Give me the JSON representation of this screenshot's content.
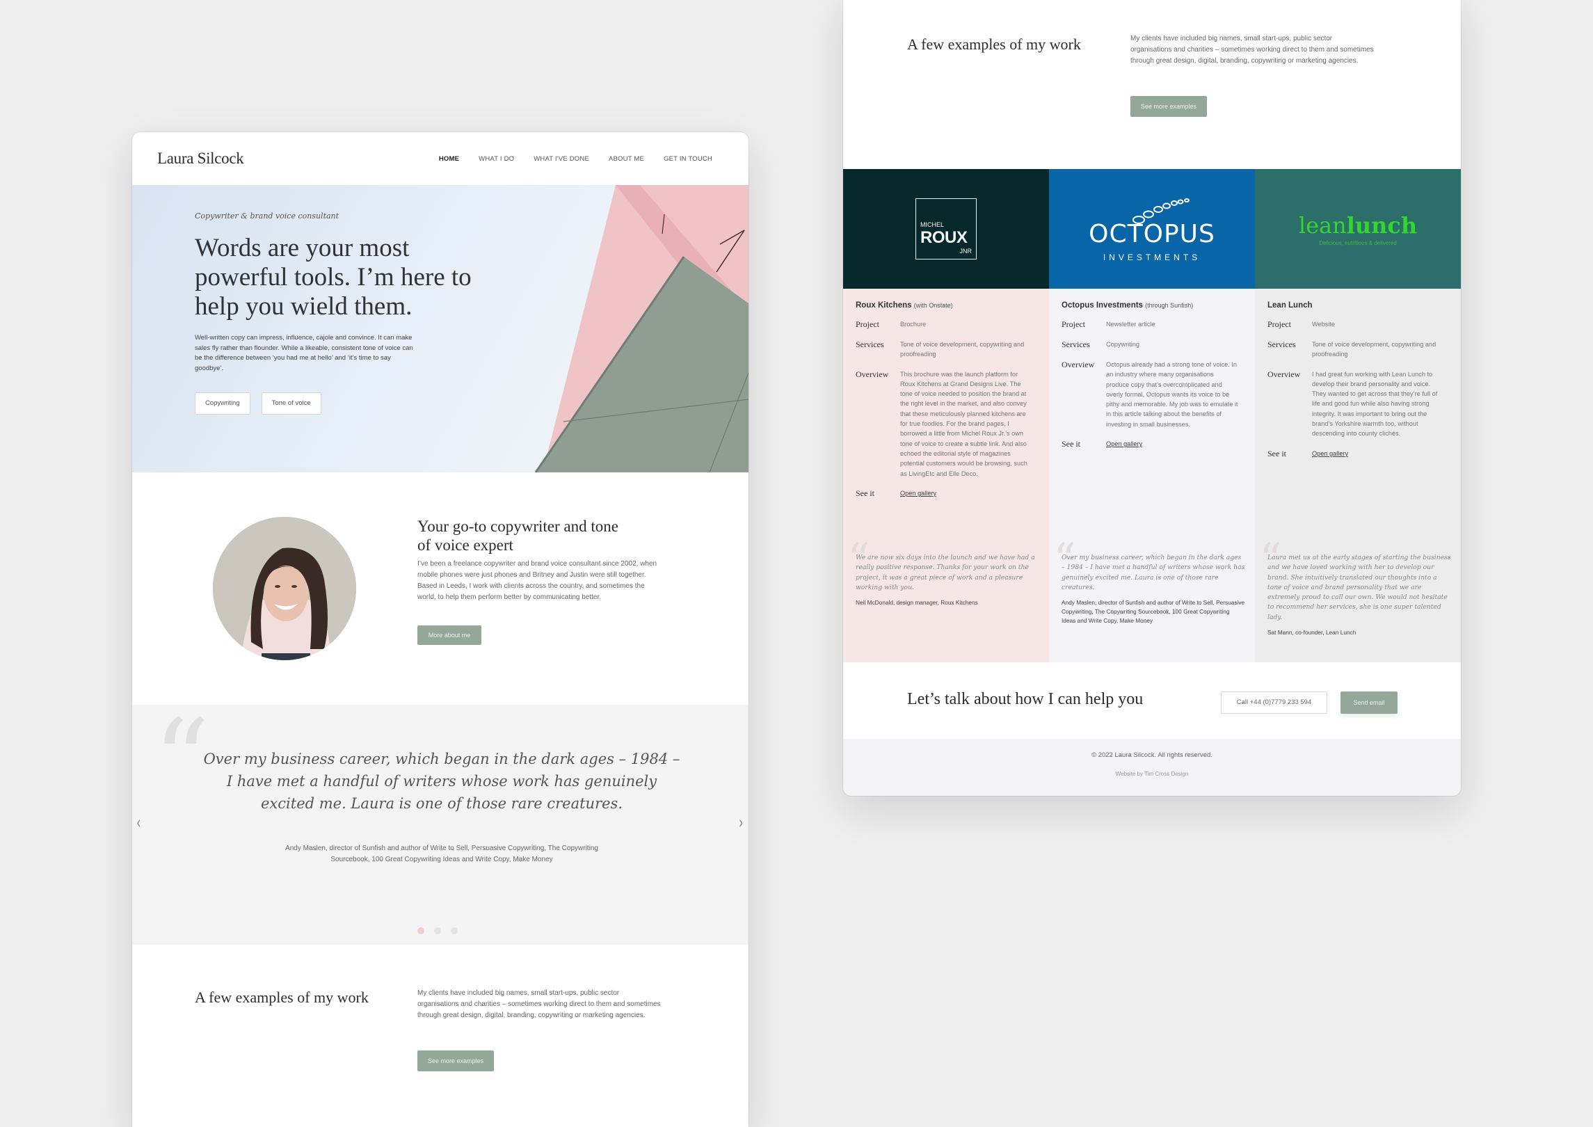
{
  "left_page": {
    "logo": "Laura Silcock",
    "nav": [
      {
        "label": "HOME",
        "active": true
      },
      {
        "label": "WHAT I DO",
        "active": false
      },
      {
        "label": "WHAT I'VE DONE",
        "active": false
      },
      {
        "label": "ABOUT ME",
        "active": false
      },
      {
        "label": "GET IN TOUCH",
        "active": false
      }
    ],
    "hero": {
      "subtitle": "Copywriter & brand voice consultant",
      "title": "Words are your most powerful tools. I’m here to help you wield them.",
      "body": "Well-written copy can impress, influence, cajole and convince. It can make sales fly rather than flounder. While a likeable, consistent tone of voice can be the difference between ‘you had me at hello’ and ‘it’s time to say goodbye’.",
      "buttons": [
        "Copywriting",
        "Tone of voice"
      ]
    },
    "about": {
      "title": "Your go-to copywriter and tone of voice expert",
      "body": "I’ve been a freelance copywriter and brand voice consultant since 2002, when mobile phones were just phones and Britney and Justin were still together. Based in Leeds, I work with clients across the country, and sometimes the world, to help them perform better by communicating better.",
      "button": "More about me"
    },
    "testimonial": {
      "quote": "Over my business career, which began in the dark ages – 1984 – I have met a handful of writers whose work has genuinely excited me. Laura is one of those rare creatures.",
      "attribution": "Andy Maslen, director of Sunfish and author of Write to Sell, Persuasive Copywriting, The Copywriting Sourcebook, 100 Great Copywriting Ideas and Write Copy, Make Money",
      "slide_count": 3,
      "active_slide": 1
    },
    "examples": {
      "title": "A few examples of my work",
      "body": "My clients have included big names, small start-ups, public sector organisations and charities – sometimes working direct to them and sometimes through great design, digital, branding, copywriting or marketing agencies.",
      "button": "See more examples"
    }
  },
  "right_page": {
    "examples": {
      "title": "A few examples of my work",
      "body": "My clients have included big names, small start-ups, public sector organisations and charities – sometimes working direct to them and sometimes through great design, digital, branding, copywriting or marketing agencies.",
      "button": "See more examples"
    },
    "logos": {
      "roux": {
        "line1": "MICHEL",
        "line2": "ROUX",
        "line3": "JNR",
        "bg": "#06282b"
      },
      "octopus": {
        "line1": "OCTOPUS",
        "line2": "INVESTMENTS",
        "bg": "#0865a8"
      },
      "leanlunch": {
        "light": "lean",
        "bold": "lunch",
        "tagline": "Delicious, nutritious & delivered",
        "bg": "#2c6e6a"
      }
    },
    "labels": {
      "project": "Project",
      "services": "Services",
      "overview": "Overview",
      "see_it": "See it",
      "link": "Open gallery"
    },
    "cases": [
      {
        "name": "Roux Kitchens",
        "via": "(with Onstate)",
        "project": "Brochure",
        "services": "Tone of voice development, copywriting and proofreading",
        "overview": "This brochure was the launch platform for Roux Kitchens at Grand Designs Live. The tone of voice needed to position the brand at the right level in the market, and also convey that these meticulously planned kitchens are for true foodies. For the brand pages, I borrowed a little from Michel Roux Jr.’s own tone of voice to create a subtle link. And also echoed the editorial style of magazines potential customers would be browsing, such as LivingEtc and Elle Deco.",
        "quote": "We are now six days into the launch and we have had a really positive response. Thanks for your work on the project, it was a great piece of work and a pleasure working with you.",
        "attribution": "Neil McDonald, design manager, Roux Kitchens",
        "bg": "#f6e6e6"
      },
      {
        "name": "Octopus Investments",
        "via": "(through Sunfish)",
        "project": "Newsletter article",
        "services": "Copywriting",
        "overview": "Octopus already had a strong tone of voice. In an industry where many organisations produce copy that’s overcomplicated and overly formal, Octopus wants its voice to be pithy and memorable. My job was to emulate it in this article talking about the benefits of investing in small businesses.",
        "quote": "Over my business career, which began in the dark ages – 1984 – I have met a handful of writers whose work has genuinely excited me. Laura is one of those rare creatures.",
        "attribution": "Andy Maslen, director of Sunfish and author of Write to Sell, Persuasive Copywriting, The Copywriting Sourcebook, 100 Great Copywriting Ideas and Write Copy, Make Money",
        "bg": "#f4f3f5"
      },
      {
        "name": "Lean Lunch",
        "via": "",
        "project": "Website",
        "services": "Tone of voice development, copywriting and proofreading",
        "overview": "I had great fun working with Lean Lunch to develop their brand personality and voice. They wanted to get across that they’re full of life and good fun while also having strong integrity. It was important to bring out the brand’s Yorkshire warmth too, without descending into county clichés.",
        "quote": "Laura met us at the early stages of starting the business and we have loved working with her to develop our brand. She intuitively translated our thoughts into a tone of voice and brand personality that we are extremely proud to call our own. We would not hesitate to recommend her services, she is one super talented lady.",
        "attribution": "Sat Mann, co-founder, Lean Lunch",
        "bg": "#ececec"
      }
    ],
    "cta": {
      "title": "Let’s talk about how I can help you",
      "call_button": "Call +44 (0)7779 233 594",
      "email_button": "Send email"
    },
    "footer": {
      "copyright": "© 2022 Laura Silcock. All rights reserved.",
      "credit": "Website by Tim Cross Design"
    }
  },
  "colors": {
    "accent_green": "#93a899",
    "pink": "#f6e6e6",
    "text_dark": "#2d2d2d"
  }
}
